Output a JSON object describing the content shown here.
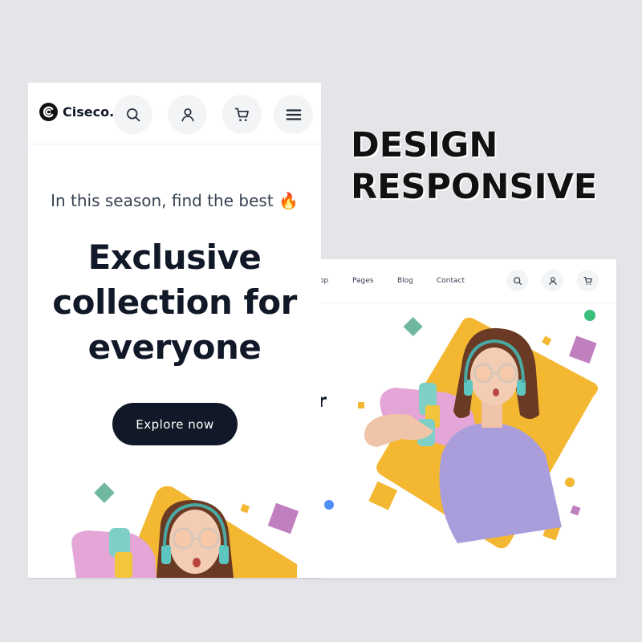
{
  "title": {
    "line1": "DESIGN",
    "line2": "RESPONSIVE"
  },
  "mobile": {
    "brand": "Ciseco.",
    "icons": [
      "search-icon",
      "user-icon",
      "cart-icon",
      "menu-icon"
    ],
    "tagline": "In this season, find the best 🔥",
    "headline": [
      "Exclusive",
      "collection for",
      "everyone"
    ],
    "cta_label": "Explore now"
  },
  "desktop": {
    "nav_links": [
      "op",
      "Pages",
      "Blog",
      "Contact"
    ],
    "icons": [
      "search-icon",
      "user-icon",
      "cart-icon"
    ],
    "headline_fragment": "or"
  },
  "colors": {
    "background": "#e5e5e9",
    "dark": "#111827",
    "accent_yellow": "#f4b731",
    "accent_purple": "#c07fbf",
    "accent_teal": "#6fb79f",
    "accent_green": "#3ac07a",
    "accent_blue": "#4f8ef7",
    "shirt_lavender": "#a99ddc"
  }
}
